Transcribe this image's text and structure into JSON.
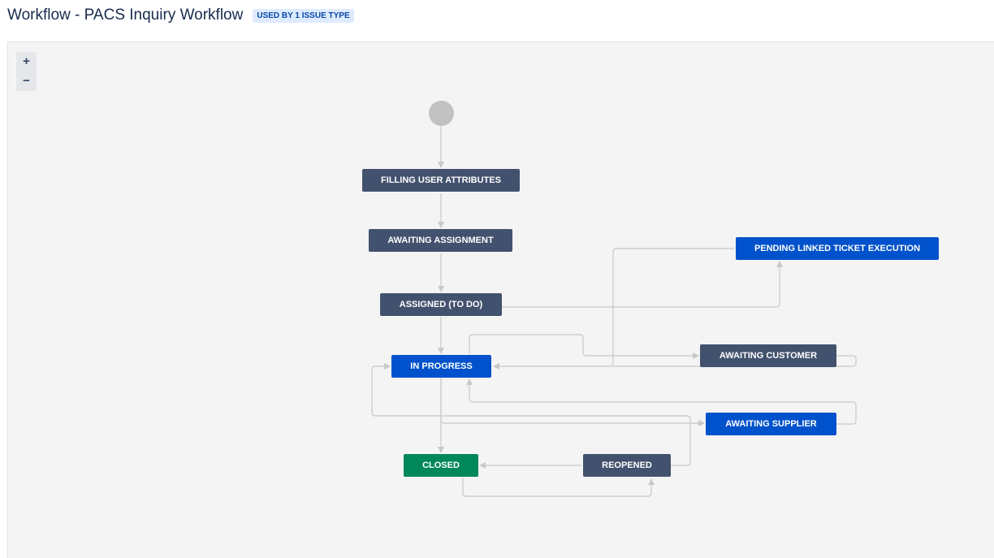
{
  "header": {
    "title": "Workflow - PACS Inquiry Workflow",
    "badge": "USED BY 1 ISSUE TYPE"
  },
  "zoom": {
    "in_label": "+",
    "out_label": "−"
  },
  "colors": {
    "dark": "#42526e",
    "blue": "#0052cc",
    "green": "#00875a",
    "start": "#c1c1c1",
    "line": "#c8c8c8"
  },
  "statuses": [
    {
      "id": "filling",
      "label": "FILLING USER ATTRIBUTES",
      "category": "dark"
    },
    {
      "id": "awaiting_assignment",
      "label": "AWAITING ASSIGNMENT",
      "category": "dark"
    },
    {
      "id": "assigned",
      "label": "ASSIGNED (TO DO)",
      "category": "dark"
    },
    {
      "id": "in_progress",
      "label": "IN PROGRESS",
      "category": "blue"
    },
    {
      "id": "pending_linked",
      "label": "PENDING LINKED TICKET EXECUTION",
      "category": "blue"
    },
    {
      "id": "awaiting_customer",
      "label": "AWAITING CUSTOMER",
      "category": "dark"
    },
    {
      "id": "awaiting_supplier",
      "label": "AWAITING SUPPLIER",
      "category": "blue"
    },
    {
      "id": "closed",
      "label": "CLOSED",
      "category": "green"
    },
    {
      "id": "reopened",
      "label": "REOPENED",
      "category": "dark"
    }
  ]
}
